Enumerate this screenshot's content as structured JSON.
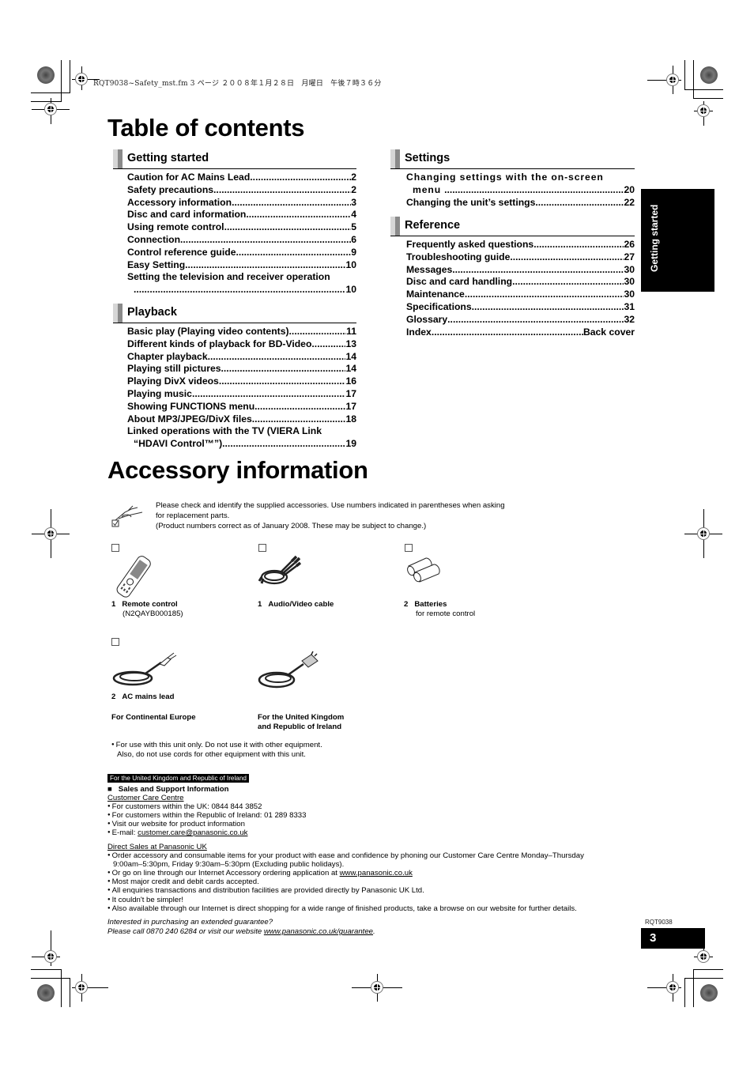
{
  "header_meta": "RQT9038~Safety_mst.fm  3 ページ  ２００８年１月２８日　月曜日　午後７時３６分",
  "toc_title": "Table of contents",
  "sections": {
    "getting_started": {
      "title": "Getting started",
      "items": [
        {
          "label": "Caution for AC Mains Lead",
          "page": "2"
        },
        {
          "label": "Safety precautions",
          "page": "2"
        },
        {
          "label": "Accessory information",
          "page": "3"
        },
        {
          "label": "Disc and card information",
          "page": "4"
        },
        {
          "label": "Using remote control",
          "page": "5"
        },
        {
          "label": "Connection",
          "page": "6"
        },
        {
          "label": "Control reference guide",
          "page": "9"
        },
        {
          "label": "Easy Setting",
          "page": "10"
        },
        {
          "label": "Setting the television and receiver operation",
          "page": "10"
        }
      ]
    },
    "playback": {
      "title": "Playback",
      "items": [
        {
          "label": "Basic play (Playing video contents)",
          "page": "11"
        },
        {
          "label": "Different kinds of playback for BD-Video",
          "page": "13"
        },
        {
          "label": "Chapter playback",
          "page": "14"
        },
        {
          "label": "Playing still pictures",
          "page": "14"
        },
        {
          "label": "Playing DivX videos",
          "page": "16"
        },
        {
          "label": "Playing music",
          "page": "17"
        },
        {
          "label": "Showing FUNCTIONS menu",
          "page": "17"
        },
        {
          "label": "About MP3/JPEG/DivX files",
          "page": "18"
        },
        {
          "label": "Linked operations with the TV (VIERA Link",
          "label2": "“HDAVI Control™”)",
          "page": "19"
        }
      ]
    },
    "settings": {
      "title": "Settings",
      "items": [
        {
          "label": "Changing settings with the on-screen",
          "label2": "menu",
          "page": "20"
        },
        {
          "label": "Changing the unit’s settings",
          "page": "22"
        }
      ]
    },
    "reference": {
      "title": "Reference",
      "items": [
        {
          "label": "Frequently asked questions",
          "page": "26"
        },
        {
          "label": "Troubleshooting guide",
          "page": "27"
        },
        {
          "label": "Messages",
          "page": "30"
        },
        {
          "label": "Disc and card handling",
          "page": "30"
        },
        {
          "label": "Maintenance",
          "page": "30"
        },
        {
          "label": "Specifications",
          "page": "31"
        },
        {
          "label": "Glossary",
          "page": "32"
        },
        {
          "label": "Index",
          "page": "Back cover"
        }
      ]
    }
  },
  "side_tab": "Getting started",
  "accessory": {
    "title": "Accessory information",
    "intro": [
      "Please check and identify the supplied accessories. Use numbers indicated in parentheses when asking",
      "for replacement parts.",
      "(Product numbers correct as of January 2008. These may be subject to change.)"
    ],
    "items": [
      {
        "qty": "1",
        "name": "Remote control",
        "sub": "(N2QAYB000185)"
      },
      {
        "qty": "1",
        "name": "Audio/Video cable",
        "sub": ""
      },
      {
        "qty": "2",
        "name": "Batteries",
        "sub": "for remote control"
      },
      {
        "qty": "2",
        "name": "AC mains lead",
        "sub": ""
      }
    ],
    "lead_variants": [
      "For Continental Europe",
      "For the United Kingdom",
      "and Republic of Ireland"
    ],
    "note": [
      "For use with this unit only. Do not use it with other equipment.",
      "Also, do not use cords for other equipment with this unit."
    ]
  },
  "uk": {
    "badge": "For the United Kingdom and Republic of Ireland",
    "heading": "Sales and Support Information",
    "care_title": "Customer Care Centre",
    "care_items": [
      "For customers within the UK: 0844 844 3852",
      "For customers within the Republic of Ireland: 01 289 8333",
      "Visit our website for product information"
    ],
    "email_label": "E-mail: ",
    "email": "customer.care@panasonic.co.uk",
    "direct_title": "Direct Sales at Panasonic UK",
    "direct_items": [
      "Order accessory and consumable items for your product with ease and confidence by phoning our Customer Care Centre Monday–Thursday",
      "9:00am–5:30pm, Friday 9:30am–5:30pm (Excluding public holidays).",
      "Or go on line through our Internet Accessory ordering application at ",
      "Most major credit and debit cards accepted.",
      "All enquiries transactions and distribution facilities are provided directly by Panasonic UK Ltd.",
      "It couldn't be simpler!",
      "Also available through our Internet is direct shopping for a wide range of finished products, take a browse on our website for further details."
    ],
    "direct_link": "www.panasonic.co.uk",
    "guarantee_q": "Interested in purchasing an extended guarantee?",
    "guarantee_text": "Please call 0870 240 6284 or visit our website ",
    "guarantee_link": "www.panasonic.co.uk/guarantee",
    "guarantee_end": "."
  },
  "footer": {
    "code": "RQT9038",
    "page": "3"
  }
}
